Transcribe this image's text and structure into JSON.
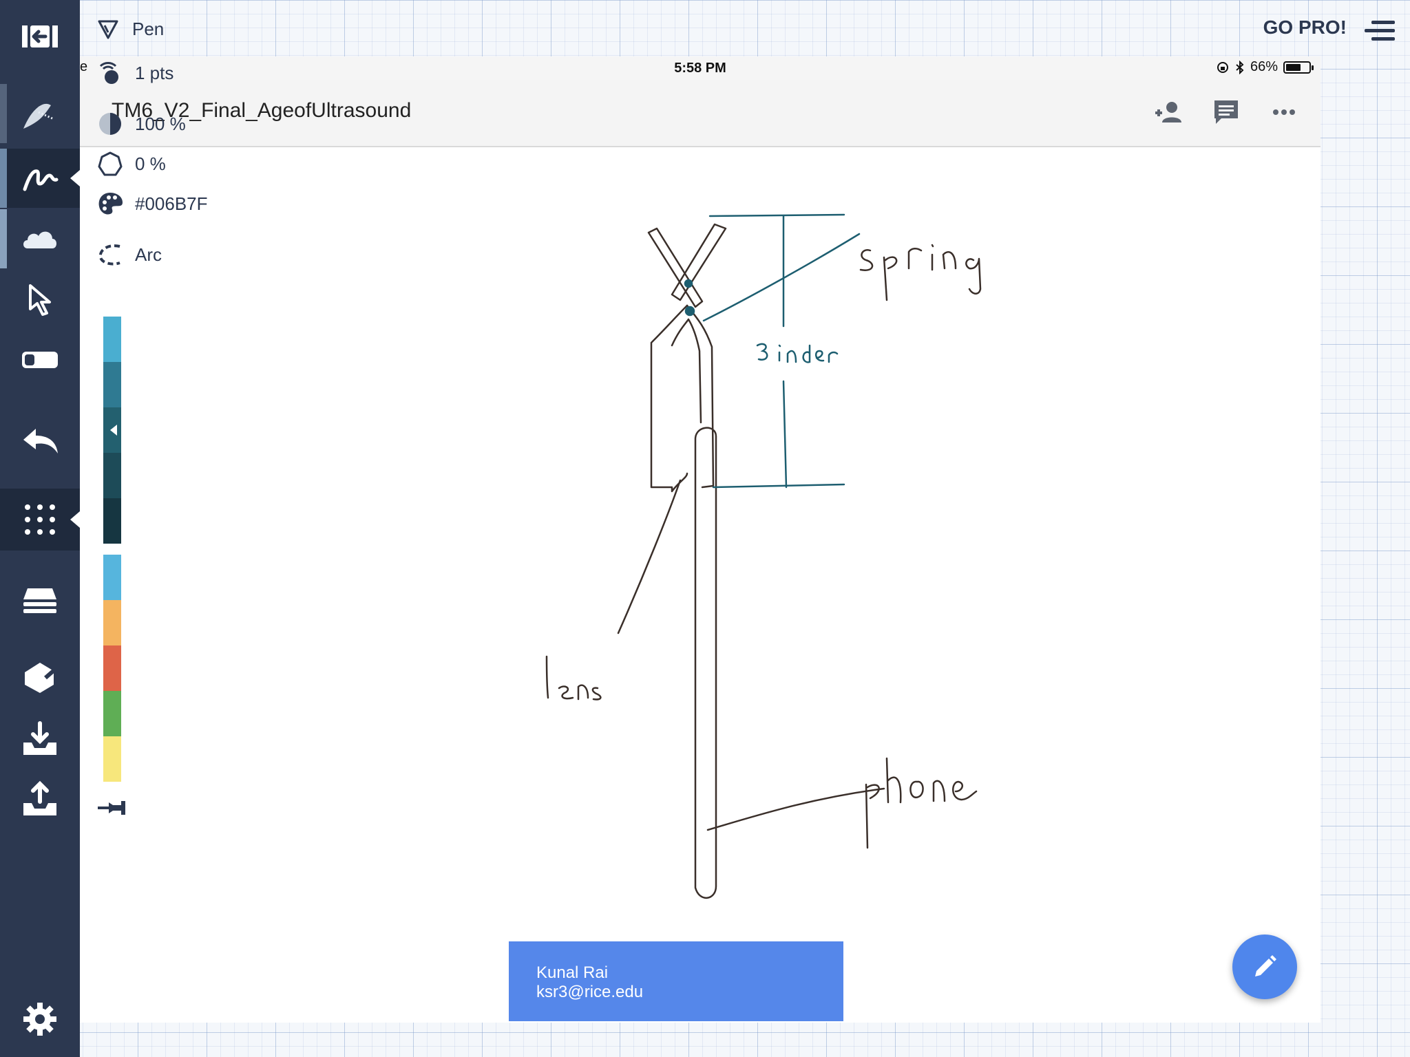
{
  "toolbar": {
    "tool_name": "Pen",
    "go_pro_label": "GO PRO!"
  },
  "pen_settings": {
    "size": "1 pts",
    "opacity": "100 %",
    "smoothing": "0 %",
    "color_hex": "#006B7F",
    "shape": "Arc"
  },
  "swatches": {
    "shades": [
      "#4aaed0",
      "#2f7a92",
      "#23606f",
      "#1d4b58",
      "#163641"
    ],
    "presets": [
      "#56b5dd",
      "#f4b460",
      "#de6448",
      "#5fae55",
      "#f7e77c"
    ]
  },
  "status_bar": {
    "left_fragment": "e",
    "time": "5:58 PM",
    "battery": "66%",
    "battery_level": 0.66
  },
  "document": {
    "title": "TM6_V2_Final_AgeofUltrasound"
  },
  "sketch_labels": {
    "spring": "spring",
    "inches": "3 inches",
    "lens": "lens",
    "phone": "phone"
  },
  "contact_card": {
    "name": "Kunal Rai",
    "email": "ksr3@rice.edu"
  },
  "icons": {
    "sidebar": [
      "exit-icon",
      "brush-preview-icon",
      "pen-tool-icon",
      "cloud-icon",
      "select-icon",
      "eraser-icon",
      "undo-icon",
      "palette-grid-icon",
      "layers-icon",
      "shape-icon",
      "import-icon",
      "export-icon",
      "settings-icon"
    ]
  },
  "colors": {
    "sidebar": "#2c3850",
    "accent_blue": "#5587ea",
    "ink_teal": "#006B7F"
  }
}
